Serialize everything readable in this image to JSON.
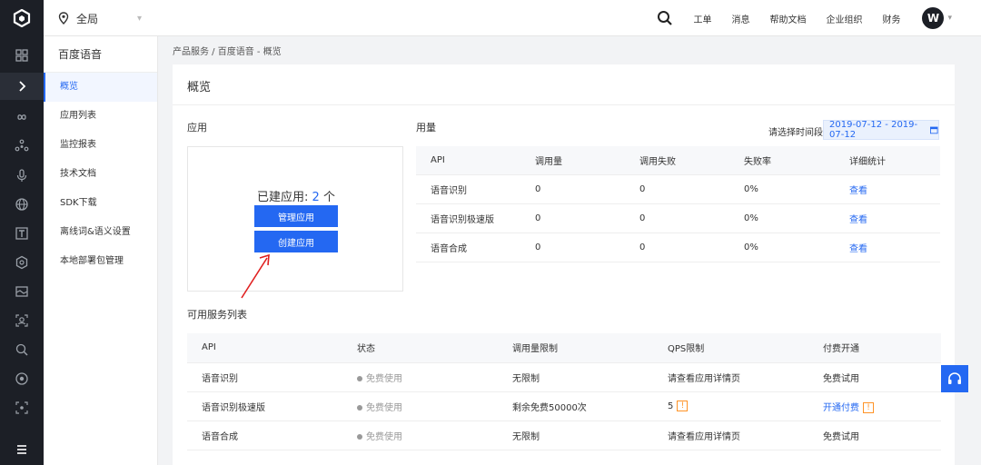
{
  "header": {
    "region": "全局",
    "nav": [
      "工单",
      "消息",
      "帮助文档",
      "企业组织",
      "财务"
    ],
    "avatar": "W"
  },
  "sidebar": {
    "title": "百度语音",
    "items": [
      {
        "label": "概览",
        "active": true
      },
      {
        "label": "应用列表"
      },
      {
        "label": "监控报表"
      },
      {
        "label": "技术文档"
      },
      {
        "label": "SDK下载"
      },
      {
        "label": "离线词&语义设置"
      },
      {
        "label": "本地部署包管理"
      }
    ]
  },
  "breadcrumb": "产品服务 / 百度语音 - 概览",
  "main": {
    "title": "概览",
    "app": {
      "section_title": "应用",
      "count_label": "已建应用: ",
      "count": "2",
      "count_unit": " 个",
      "manage_button": "管理应用",
      "create_button": "创建应用"
    },
    "usage": {
      "section_title": "用量",
      "date_label": "请选择时间段",
      "date_range": "2019-07-12 - 2019-07-12",
      "columns": [
        "API",
        "调用量",
        "调用失败",
        "失败率",
        "详细统计"
      ],
      "rows": [
        [
          "语音识别",
          "0",
          "0",
          "0%",
          "查看"
        ],
        [
          "语音识别极速版",
          "0",
          "0",
          "0%",
          "查看"
        ],
        [
          "语音合成",
          "0",
          "0",
          "0%",
          "查看"
        ]
      ]
    },
    "services": {
      "section_title": "可用服务列表",
      "columns": [
        "API",
        "状态",
        "调用量限制",
        "QPS限制",
        "付费开通"
      ],
      "rows": [
        [
          "语音识别",
          "免费使用",
          "无限制",
          "请查看应用详情页",
          "免费试用"
        ],
        [
          "语音识别极速版",
          "免费使用",
          "剩余免费50000次",
          "5",
          "开通付费"
        ],
        [
          "语音合成",
          "免费使用",
          "无限制",
          "请查看应用详情页",
          "免费试用"
        ]
      ],
      "warn_mark": "!"
    }
  },
  "colors": {
    "accent": "#2468f2",
    "rail": "#1c1f26",
    "warn": "#ff9326"
  }
}
